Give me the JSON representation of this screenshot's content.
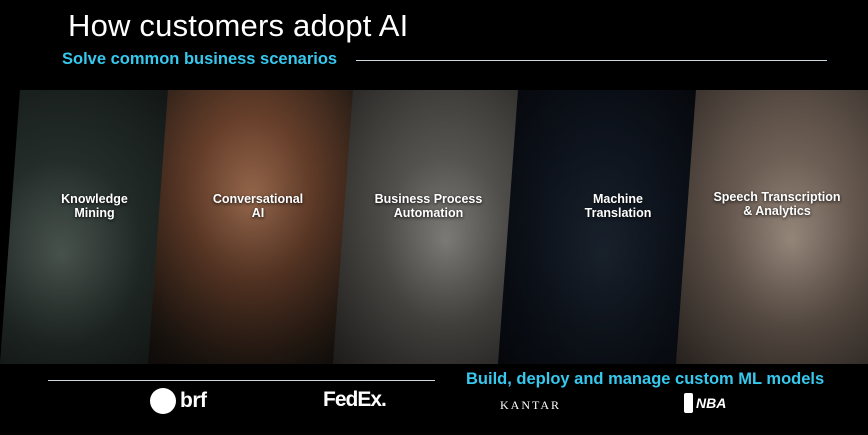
{
  "header": {
    "title": "How customers adopt AI",
    "subtitle": "Solve common business scenarios"
  },
  "scenarios": [
    {
      "line1": "Knowledge",
      "line2": "Mining"
    },
    {
      "line1": "Conversational",
      "line2": "AI"
    },
    {
      "line1": "Business Process",
      "line2": "Automation"
    },
    {
      "line1": "Machine",
      "line2": "Translation"
    },
    {
      "line1": "Speech Transcription",
      "line2": "& Analytics"
    }
  ],
  "footer": {
    "tagline": "Build, deploy and manage custom ML models",
    "logos": {
      "brf": "brf",
      "fedex": "FedEx.",
      "kantar": "KANTAR",
      "nba": "NBA"
    }
  },
  "colors": {
    "accent": "#37c8ee",
    "background": "#000000"
  }
}
